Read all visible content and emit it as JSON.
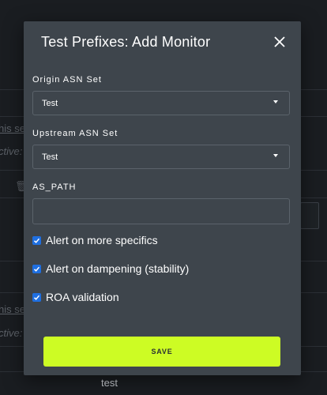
{
  "background": {
    "snippets": {
      "left_1": "his set",
      "left_2": "ctive:",
      "left_3": "his set",
      "left_4": "ctive:",
      "bottom": "test"
    }
  },
  "modal": {
    "title": "Test Prefixes: Add Monitor",
    "close_icon": "close-icon",
    "origin_asn": {
      "label": "Origin ASN Set",
      "value": "Test"
    },
    "upstream_asn": {
      "label": "Upstream ASN Set",
      "value": "Test"
    },
    "as_path": {
      "label": "AS_PATH",
      "value": "",
      "placeholder": ""
    },
    "checkboxes": [
      {
        "label": "Alert on more specifics",
        "checked": true
      },
      {
        "label": "Alert on dampening (stability)",
        "checked": true
      },
      {
        "label": "ROA validation",
        "checked": true
      }
    ],
    "save_label": "SAVE"
  },
  "colors": {
    "modal_bg": "#3e454c",
    "accent": "#cdfc24",
    "checkbox": "#1f6fe0"
  }
}
